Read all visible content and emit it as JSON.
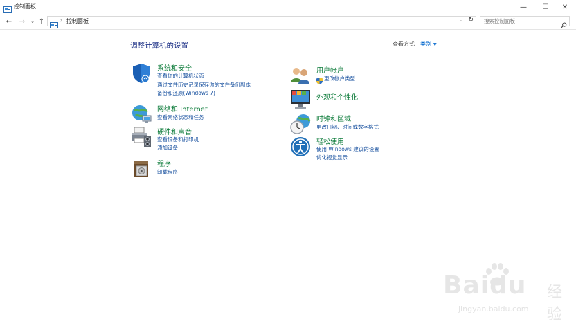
{
  "window": {
    "title": "控制面板",
    "minimize_glyph": "—",
    "maximize_glyph": "☐",
    "close_glyph": "✕"
  },
  "address": {
    "crumb": "控制面板",
    "separator": "›",
    "dropdown_glyph": "⌄",
    "refresh_glyph": "↻",
    "back_glyph": "←",
    "forward_glyph": "→",
    "recent_glyph": "⌄",
    "up_glyph": "↑"
  },
  "search": {
    "placeholder": "搜索控制面板"
  },
  "page": {
    "title": "调整计算机的设置"
  },
  "viewby": {
    "label": "查看方式",
    "value": "类别",
    "arrow": "▼"
  },
  "categories": {
    "system": {
      "icon": "shield-icon",
      "title": "系统和安全",
      "links": [
        "查看你的计算机状态",
        "通过文件历史记录保存你的文件备份副本",
        "备份和还原(Windows 7)"
      ]
    },
    "network": {
      "icon": "globe-network-icon",
      "title": "网络和 Internet",
      "links": [
        "查看网络状态和任务"
      ]
    },
    "hardware": {
      "icon": "printer-icon",
      "title": "硬件和声音",
      "links": [
        "查看设备和打印机",
        "添加设备"
      ]
    },
    "programs": {
      "icon": "programs-icon",
      "title": "程序",
      "links": [
        "卸载程序"
      ]
    },
    "users": {
      "icon": "users-icon",
      "title": "用户帐户",
      "links": [
        "更改帐户类型"
      ]
    },
    "appearance": {
      "icon": "monitor-icon",
      "title": "外观和个性化",
      "links": []
    },
    "clock": {
      "icon": "clock-globe-icon",
      "title": "时钟和区域",
      "links": [
        "更改日期、时间或数字格式"
      ]
    },
    "ease": {
      "icon": "ease-of-access-icon",
      "title": "轻松使用",
      "links": [
        "使用 Windows 建议的设置",
        "优化视觉显示"
      ]
    }
  },
  "watermark": {
    "brand": "Baidu",
    "sub": "经验",
    "url": "jingyan.baidu.com"
  },
  "colors": {
    "title_blue": "#1e3287",
    "category_green": "#0a7a38",
    "link_blue": "#1b53a0",
    "accent_blue": "#0066cc"
  }
}
